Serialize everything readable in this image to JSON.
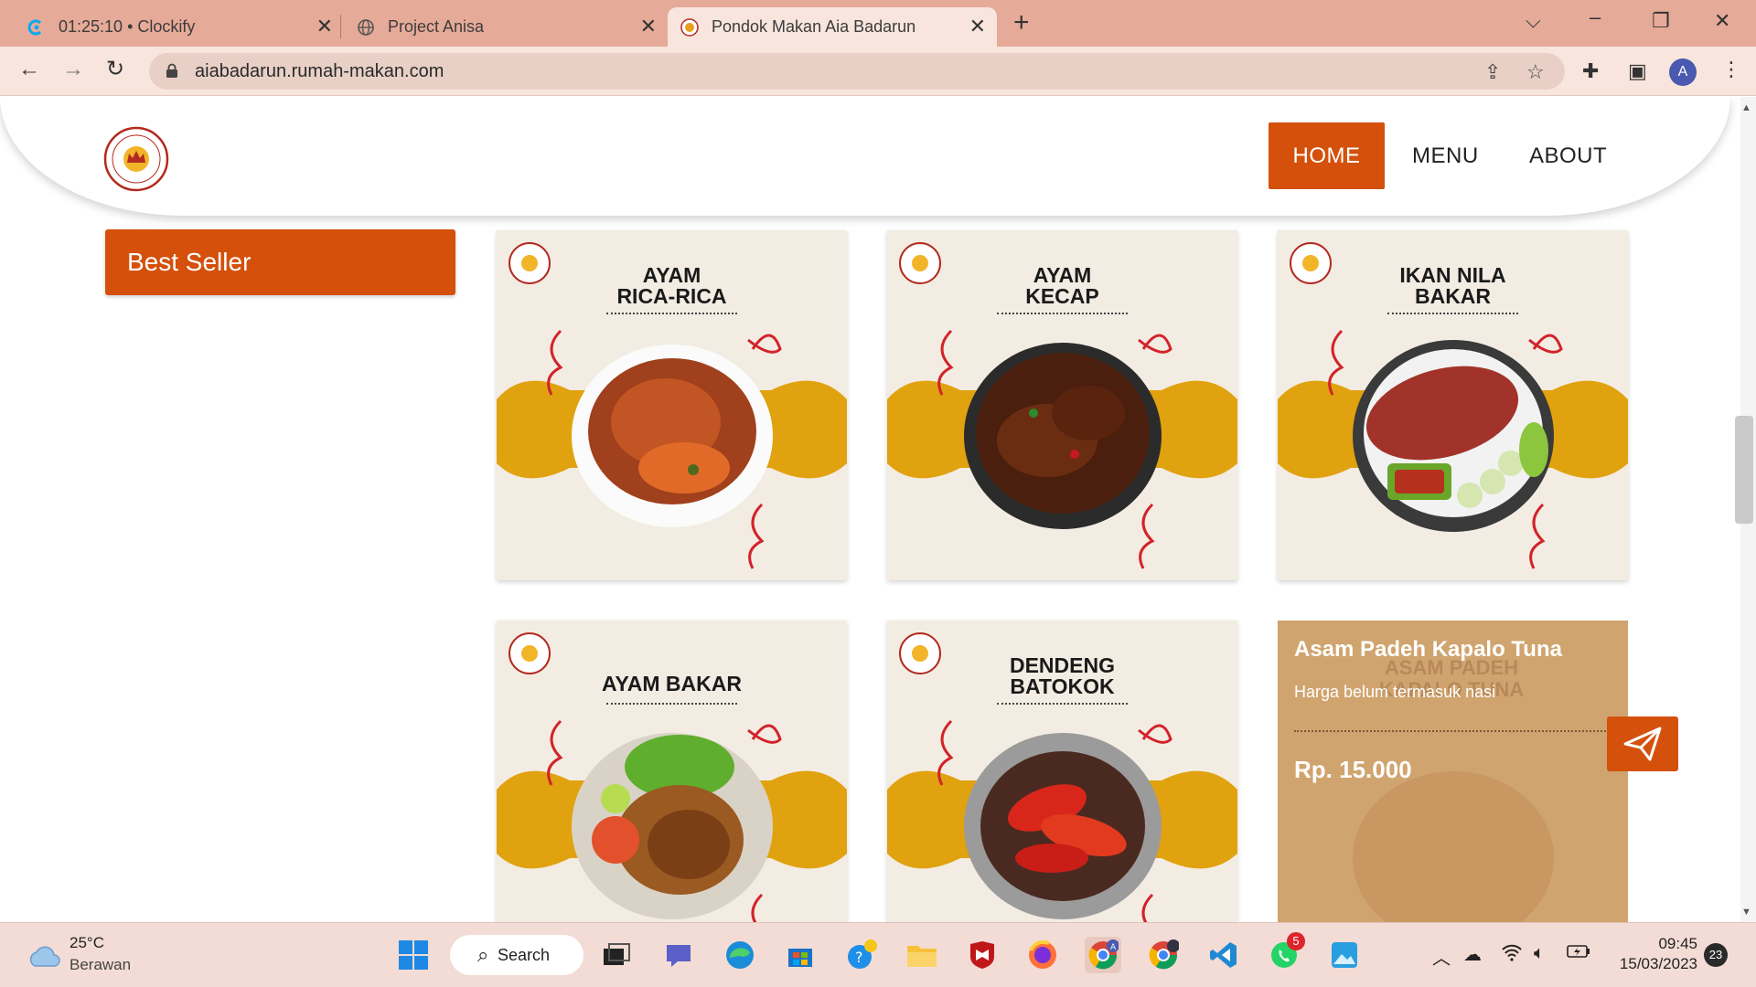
{
  "browser": {
    "tabs": [
      {
        "title": "01:25:10 • Clockify",
        "icon": "clockify-icon"
      },
      {
        "title": "Project Anisa",
        "icon": "globe-icon"
      },
      {
        "title": "Pondok Makan Aia Badarun",
        "icon": "site-logo-icon"
      }
    ],
    "url": "aiabadarun.rumah-makan.com",
    "profile_initial": "A"
  },
  "site": {
    "nav": {
      "home": "HOME",
      "menu": "MENU",
      "about": "ABOUT"
    },
    "sidebar": {
      "best_seller": "Best Seller"
    },
    "menu_items": [
      {
        "line1": "AYAM",
        "line2": "RICA-RICA",
        "dish": "chicken-in-chili-sauce"
      },
      {
        "line1": "AYAM",
        "line2": "KECAP",
        "dish": "chicken-in-soy-sauce"
      },
      {
        "line1": "IKAN NILA",
        "line2": "BAKAR",
        "dish": "grilled-tilapia"
      },
      {
        "line1": "AYAM BAKAR",
        "line2": "",
        "dish": "grilled-chicken"
      },
      {
        "line1": "DENDENG",
        "line2": "BATOKOK",
        "dish": "beef-jerky-with-chili"
      }
    ],
    "hover_card": {
      "ghost_line1": "ASAM PADEH",
      "ghost_line2": "KAPALO TUNA",
      "name": "Asam Padeh Kapalo Tuna",
      "note": "Harga belum termasuk nasi",
      "price": "Rp. 15.000"
    },
    "colors": {
      "accent": "#d4500b",
      "card_bg": "#f3ece2",
      "wave": "#e0a20f",
      "squiggle": "#d2232a"
    }
  },
  "taskbar": {
    "weather": {
      "temp": "25°C",
      "condition": "Berawan"
    },
    "search_label": "Search",
    "time": "09:45",
    "date": "15/03/2023",
    "notifications": "23",
    "whatsapp_badge": "5"
  }
}
